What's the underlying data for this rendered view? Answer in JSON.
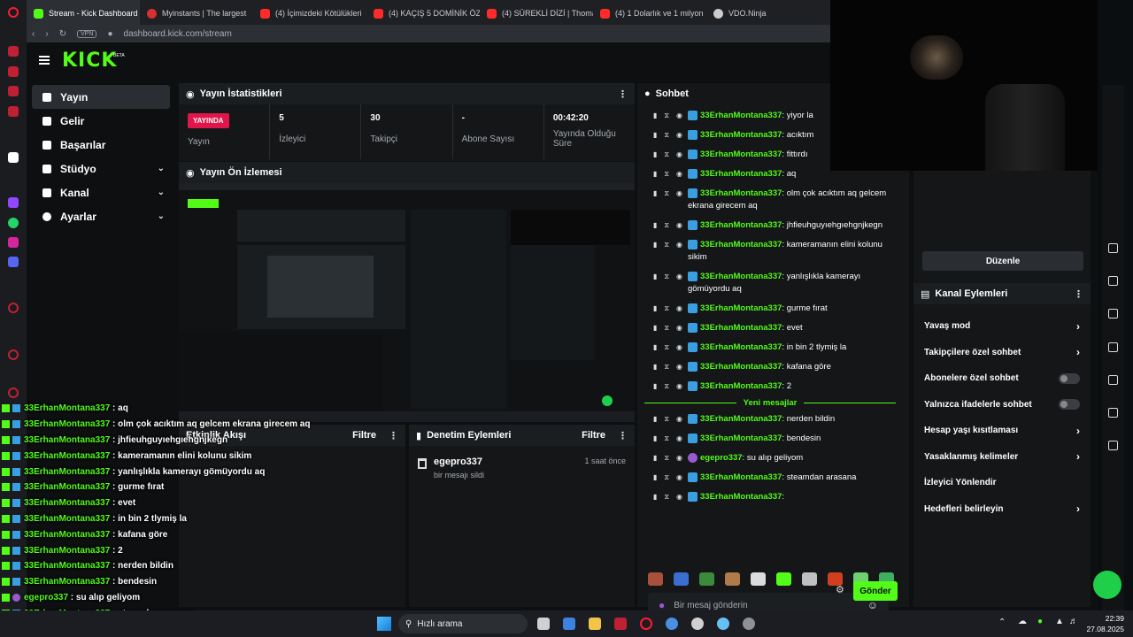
{
  "tabs": [
    {
      "label": "Stream - Kick Dashboard",
      "color": "#53fc18"
    },
    {
      "label": "Myinstants | The largest",
      "color": "#d83030"
    },
    {
      "label": "(4) İçimizdeki Kötülükleri",
      "color": "#ff2a2a"
    },
    {
      "label": "(4) KAÇIŞ 5 DOMİNİK ÖZ",
      "color": "#ff2a2a"
    },
    {
      "label": "(4) SÜREKLİ DİZİ | Thoma",
      "color": "#ff2a2a"
    },
    {
      "label": "(4) 1 Dolarlık ve 1 milyon",
      "color": "#ff2a2a"
    },
    {
      "label": "VDO.Ninja",
      "color": "#cccccc"
    }
  ],
  "address": {
    "vpn": "VPN",
    "url": "dashboard.kick.com/stream"
  },
  "logo": {
    "text": "KICK",
    "beta": "BETA"
  },
  "sidebar": [
    {
      "label": "Yayın",
      "active": true,
      "chevron": false
    },
    {
      "label": "Gelir",
      "active": false,
      "chevron": false
    },
    {
      "label": "Başarılar",
      "active": false,
      "chevron": false
    },
    {
      "label": "Stüdyo",
      "active": false,
      "chevron": true
    },
    {
      "label": "Kanal",
      "active": false,
      "chevron": true
    },
    {
      "label": "Ayarlar",
      "active": false,
      "chevron": true
    }
  ],
  "stats": {
    "title": "Yayın İstatistikleri",
    "live_badge": "YAYINDA",
    "live_label": "Yayın",
    "viewers_value": "5",
    "viewers_label": "İzleyici",
    "followers_value": "30",
    "followers_label": "Takipçi",
    "subs_value": "-",
    "subs_label": "Abone Sayısı",
    "uptime_value": "00:42:20",
    "uptime_label": "Yayında Olduğu Süre"
  },
  "preview": {
    "title": "Yayın Ön İzlemesi"
  },
  "activity": {
    "title": "Etkinlik Akışı",
    "filter": "Filtre"
  },
  "moderation": {
    "title": "Denetim Eylemleri",
    "filter": "Filtre",
    "entry_user": "egepro337",
    "entry_action": "bir mesajı sildi",
    "entry_time": "1 saat önce"
  },
  "chat": {
    "title": "Sohbet",
    "new_messages": "Yeni mesajlar",
    "placeholder": "Bir mesaj gönderin",
    "send": "Gönder",
    "messages_before": [
      {
        "user": "33ErhanMontana337",
        "text": "yiyor la"
      },
      {
        "user": "33ErhanMontana337",
        "text": "acıktım"
      },
      {
        "user": "33ErhanMontana337",
        "text": "fittırdı"
      },
      {
        "user": "33ErhanMontana337",
        "text": "aq"
      },
      {
        "user": "33ErhanMontana337",
        "text": "olm çok acıktım aq gelcem ekrana girecem aq"
      },
      {
        "user": "33ErhanMontana337",
        "text": "jhfieuhguyıehgıehgnjkegn"
      },
      {
        "user": "33ErhanMontana337",
        "text": "kameramanın elini kolunu sikim"
      },
      {
        "user": "33ErhanMontana337",
        "text": "yanlışlıkla kamerayı gömüyordu aq"
      },
      {
        "user": "33ErhanMontana337",
        "text": "gurme fırat"
      },
      {
        "user": "33ErhanMontana337",
        "text": "evet"
      },
      {
        "user": "33ErhanMontana337",
        "text": "in bin 2 tlymiş la"
      },
      {
        "user": "33ErhanMontana337",
        "text": "kafana göre"
      },
      {
        "user": "33ErhanMontana337",
        "text": "2"
      }
    ],
    "messages_after": [
      {
        "user": "33ErhanMontana337",
        "text": "nerden bildin"
      },
      {
        "user": "33ErhanMontana337",
        "text": "bendesin"
      },
      {
        "user": "egepro337",
        "text": "su alıp geliyom",
        "mic": true
      },
      {
        "user": "33ErhanMontana337",
        "text": "steamdan arasana"
      },
      {
        "user": "33ErhanMontana337",
        "text": ""
      }
    ],
    "emote_colors": [
      "#a8503c",
      "#3a6fd0",
      "#3c8a3c",
      "#b07a4a",
      "#dcdcdc",
      "#53fc18",
      "#c0c0c0",
      "#d04020",
      "#6fd06f",
      "#3cb060"
    ]
  },
  "right_panel": {
    "edit": "Düzenle",
    "actions_title": "Kanal Eylemleri",
    "actions": [
      {
        "label": "Yavaş mod",
        "type": "arrow"
      },
      {
        "label": "Takipçilere özel sohbet",
        "type": "arrow"
      },
      {
        "label": "Abonelere özel sohbet",
        "type": "toggle"
      },
      {
        "label": "Yalnızca ifadelerle sohbet",
        "type": "toggle"
      },
      {
        "label": "Hesap yaşı kısıtlaması",
        "type": "arrow"
      },
      {
        "label": "Yasaklanmış kelimeler",
        "type": "arrow"
      },
      {
        "label": "İzleyici Yönlendir",
        "type": "none"
      },
      {
        "label": "Hedefleri belirleyin",
        "type": "arrow"
      }
    ]
  },
  "overlay": [
    {
      "user": "33ErhanMontana337",
      "text": "aq"
    },
    {
      "user": "33ErhanMontana337",
      "text": "olm çok acıktım aq gelcem ekrana girecem aq"
    },
    {
      "user": "33ErhanMontana337",
      "text": "jhfieuhguyıehgıehgnjkegn"
    },
    {
      "user": "33ErhanMontana337",
      "text": "kameramanın elini kolunu sikim"
    },
    {
      "user": "33ErhanMontana337",
      "text": "yanlışlıkla kamerayı gömüyordu aq"
    },
    {
      "user": "33ErhanMontana337",
      "text": "gurme fırat"
    },
    {
      "user": "33ErhanMontana337",
      "text": "evet"
    },
    {
      "user": "33ErhanMontana337",
      "text": "in bin 2 tlymiş la"
    },
    {
      "user": "33ErhanMontana337",
      "text": "kafana göre"
    },
    {
      "user": "33ErhanMontana337",
      "text": "2"
    },
    {
      "user": "33ErhanMontana337",
      "text": "nerden bildin"
    },
    {
      "user": "33ErhanMontana337",
      "text": "bendesin"
    },
    {
      "user": "egepro337",
      "text": "su alıp geliyom",
      "mic": true
    },
    {
      "user": "33ErhanMontana337",
      "text": "steamdan arasana"
    },
    {
      "user": "33ErhanMontana337",
      "text": ""
    }
  ],
  "taskbar": {
    "search": "Hızlı arama",
    "time": "22:39",
    "date": "27.08.2025"
  }
}
